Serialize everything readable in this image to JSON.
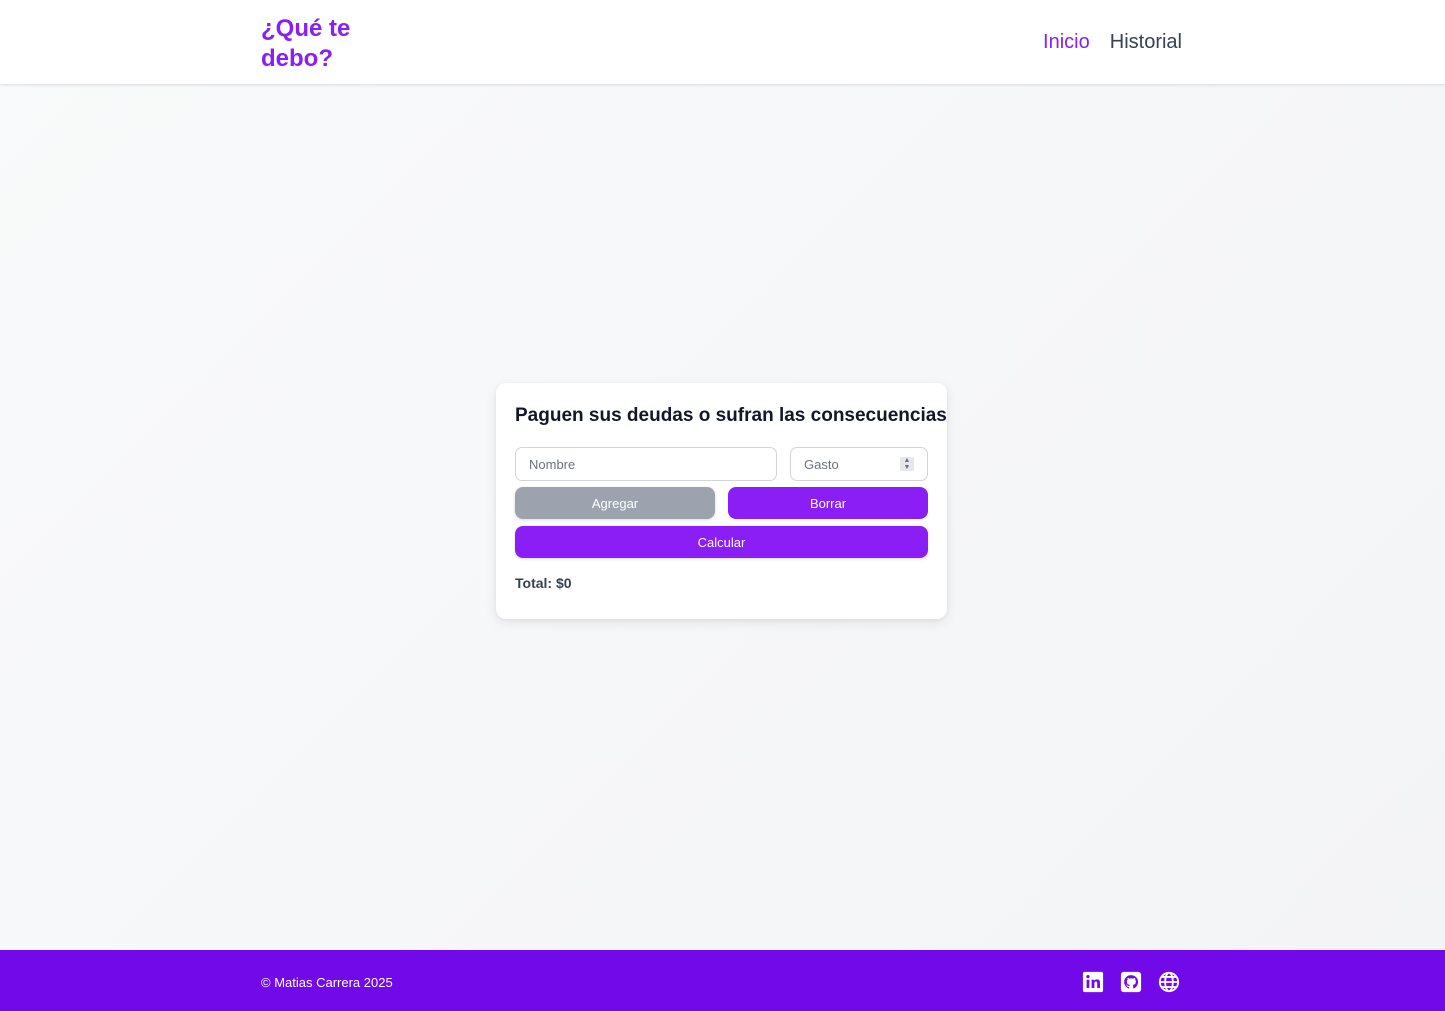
{
  "header": {
    "logo": "¿Qué te debo?",
    "nav": [
      {
        "label": "Inicio",
        "active": true
      },
      {
        "label": "Historial",
        "active": false
      }
    ]
  },
  "card": {
    "title": "Paguen sus deudas o sufran las consecuencias",
    "name_input": {
      "value": "",
      "placeholder": "Nombre"
    },
    "gasto_input": {
      "value": "",
      "placeholder": "Gasto"
    },
    "add_label": "Agregar",
    "delete_label": "Borrar",
    "calc_label": "Calcular",
    "total_text": "Total: $0"
  },
  "footer": {
    "copyright": "© Matias Carrera 2025",
    "social_icons": [
      "linkedin-icon",
      "github-icon",
      "globe-icon"
    ]
  },
  "colors": {
    "accent": "#8a1ef5",
    "footer_bg": "#7209e8",
    "disabled_button": "#9ca3af"
  }
}
